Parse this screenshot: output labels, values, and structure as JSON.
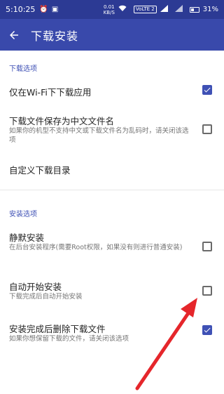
{
  "status_bar": {
    "time": "5:10:25",
    "speed_value": "0.01",
    "speed_unit": "KB/S",
    "volte": "VoLTE 2",
    "battery": "31%"
  },
  "appbar": {
    "title": "下载安装",
    "back_icon": "arrow-left-icon"
  },
  "sections": {
    "download": {
      "header": "下载选项",
      "items": [
        {
          "title": "仅在Wi-Fi下下载应用",
          "summary": "",
          "checked": true
        },
        {
          "title": "下载文件保存为中文文件名",
          "summary": "如果你的机型不支持中文或下载文件名为乱码时，请关闭该选项",
          "checked": false
        },
        {
          "title": "自定义下载目录",
          "summary": ""
        }
      ]
    },
    "install": {
      "header": "安装选项",
      "items": [
        {
          "title": "静默安装",
          "summary": "在后台安装程序(需要Root权限，如果没有则进行普通安装)",
          "checked": false
        },
        {
          "title": "自动开始安装",
          "summary": "下载完成后自动开始安装",
          "checked": false
        },
        {
          "title": "安装完成后删除下载文件",
          "summary": "如果你想保留下载的文件，请关闭该选项",
          "checked": true
        }
      ]
    }
  },
  "colors": {
    "status_bar": "#2c3a94",
    "app_bar": "#3949ab",
    "accent": "#3f51b5",
    "annotation_arrow": "#e5262b"
  }
}
